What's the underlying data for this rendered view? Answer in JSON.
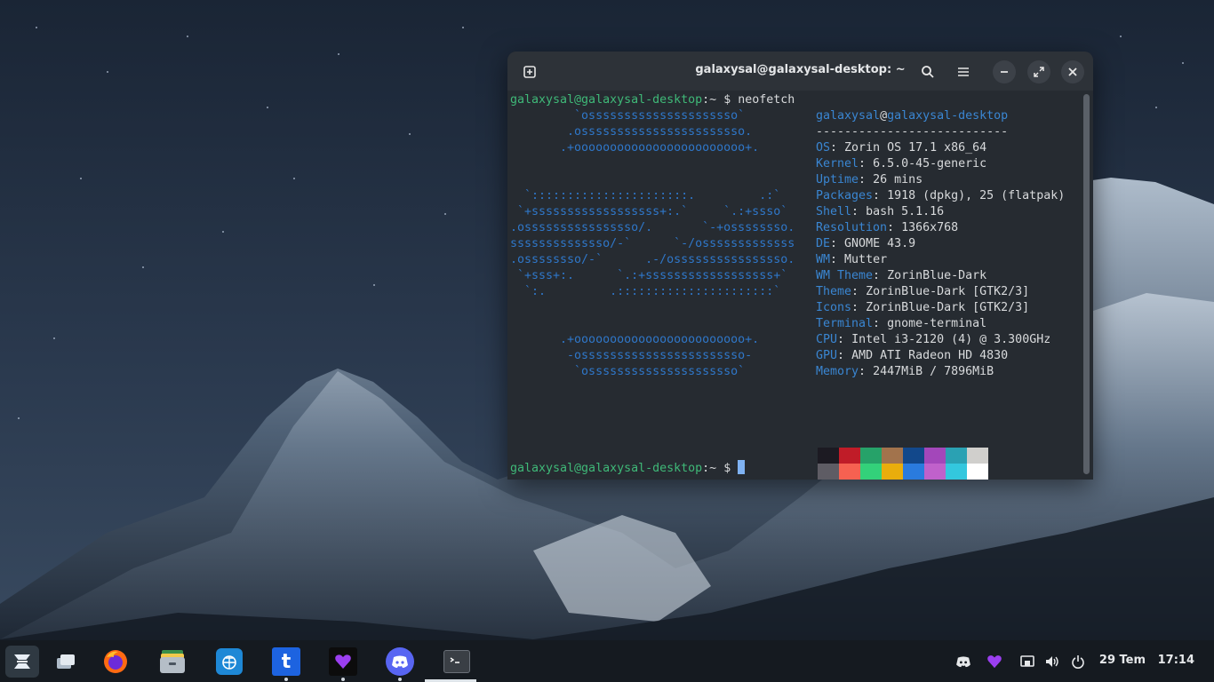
{
  "window": {
    "title": "galaxysal@galaxysal-desktop: ~",
    "new_tab_icon": "plus-square-icon",
    "search_icon": "search-icon",
    "menu_icon": "hamburger-icon",
    "minimize_icon": "minimize-icon",
    "maximize_icon": "maximize-icon",
    "close_icon": "close-icon"
  },
  "terminal": {
    "prompt_user": "galaxysal@galaxysal-desktop",
    "prompt_sep": ":~",
    "prompt_dollar": "$",
    "command": "neofetch",
    "art": [
      "         `osssssssssssssssssssso`",
      "        .osssssssssssssssssssssso.",
      "       .+oooooooooooooooooooooooo+.",
      "",
      "",
      "  `::::::::::::::::::::::.         .:`",
      " `+ssssssssssssssssss+:.`     `.:+ssso`",
      ".ossssssssssssssso/.       `-+ossssssso.",
      "ssssssssssssso/-`      `-/osssssssssssss",
      ".ossssssso/-`      .-/ossssssssssssssso.",
      " `+sss+:.      `.:+ssssssssssssssssss+`",
      "  `:.         .::::::::::::::::::::::`",
      "",
      "",
      "       .+oooooooooooooooooooooooo+.",
      "        -osssssssssssssssssssssso-",
      "         `osssssssssssssssssssso`"
    ],
    "host_user": "galaxysal",
    "host_at": "@",
    "host_name": "galaxysal-desktop",
    "separator": "---------------------------",
    "info": [
      {
        "key": "OS",
        "value": "Zorin OS 17.1 x86_64"
      },
      {
        "key": "Kernel",
        "value": "6.5.0-45-generic"
      },
      {
        "key": "Uptime",
        "value": "26 mins"
      },
      {
        "key": "Packages",
        "value": "1918 (dpkg), 25 (flatpak)"
      },
      {
        "key": "Shell",
        "value": "bash 5.1.16"
      },
      {
        "key": "Resolution",
        "value": "1366x768"
      },
      {
        "key": "DE",
        "value": "GNOME 43.9"
      },
      {
        "key": "WM",
        "value": "Mutter"
      },
      {
        "key": "WM Theme",
        "value": "ZorinBlue-Dark"
      },
      {
        "key": "Theme",
        "value": "ZorinBlue-Dark [GTK2/3]"
      },
      {
        "key": "Icons",
        "value": "ZorinBlue-Dark [GTK2/3]"
      },
      {
        "key": "Terminal",
        "value": "gnome-terminal"
      },
      {
        "key": "CPU",
        "value": "Intel i3-2120 (4) @ 3.300GHz"
      },
      {
        "key": "GPU",
        "value": "AMD ATI Radeon HD 4830"
      },
      {
        "key": "Memory",
        "value": "2447MiB / 7896MiB"
      }
    ],
    "palette_top": [
      "#1c1a22",
      "#c01c28",
      "#26a269",
      "#a2734c",
      "#12488b",
      "#a347ba",
      "#2aa1b3",
      "#d0cfcc"
    ],
    "palette_bottom": [
      "#5e5c64",
      "#f66151",
      "#33d17a",
      "#e9ad0c",
      "#2a7bde",
      "#c061cb",
      "#33c7de",
      "#ffffff"
    ],
    "colon": ":"
  },
  "taskbar": {
    "apps": [
      {
        "name": "zorin-menu-icon",
        "color": "#2f3942"
      },
      {
        "name": "workspaces-icon",
        "color": "transparent"
      },
      {
        "name": "firefox-icon",
        "color": "transparent"
      },
      {
        "name": "files-icon",
        "color": "transparent"
      },
      {
        "name": "software-store-icon",
        "color": "#1e88d6"
      },
      {
        "name": "tutanota-icon",
        "color": "#1d63e0"
      },
      {
        "name": "heart-app-icon",
        "color": "#0c0c0c"
      },
      {
        "name": "discord-icon",
        "color": "#5865f2"
      },
      {
        "name": "terminal-icon",
        "color": "#3a3f45"
      }
    ],
    "tray": [
      "discord-tray-icon",
      "heart-tray-icon",
      "network-icon",
      "volume-icon",
      "power-icon"
    ],
    "date": "29 Tem",
    "time": "17:14",
    "tutanota_letter": "t"
  }
}
